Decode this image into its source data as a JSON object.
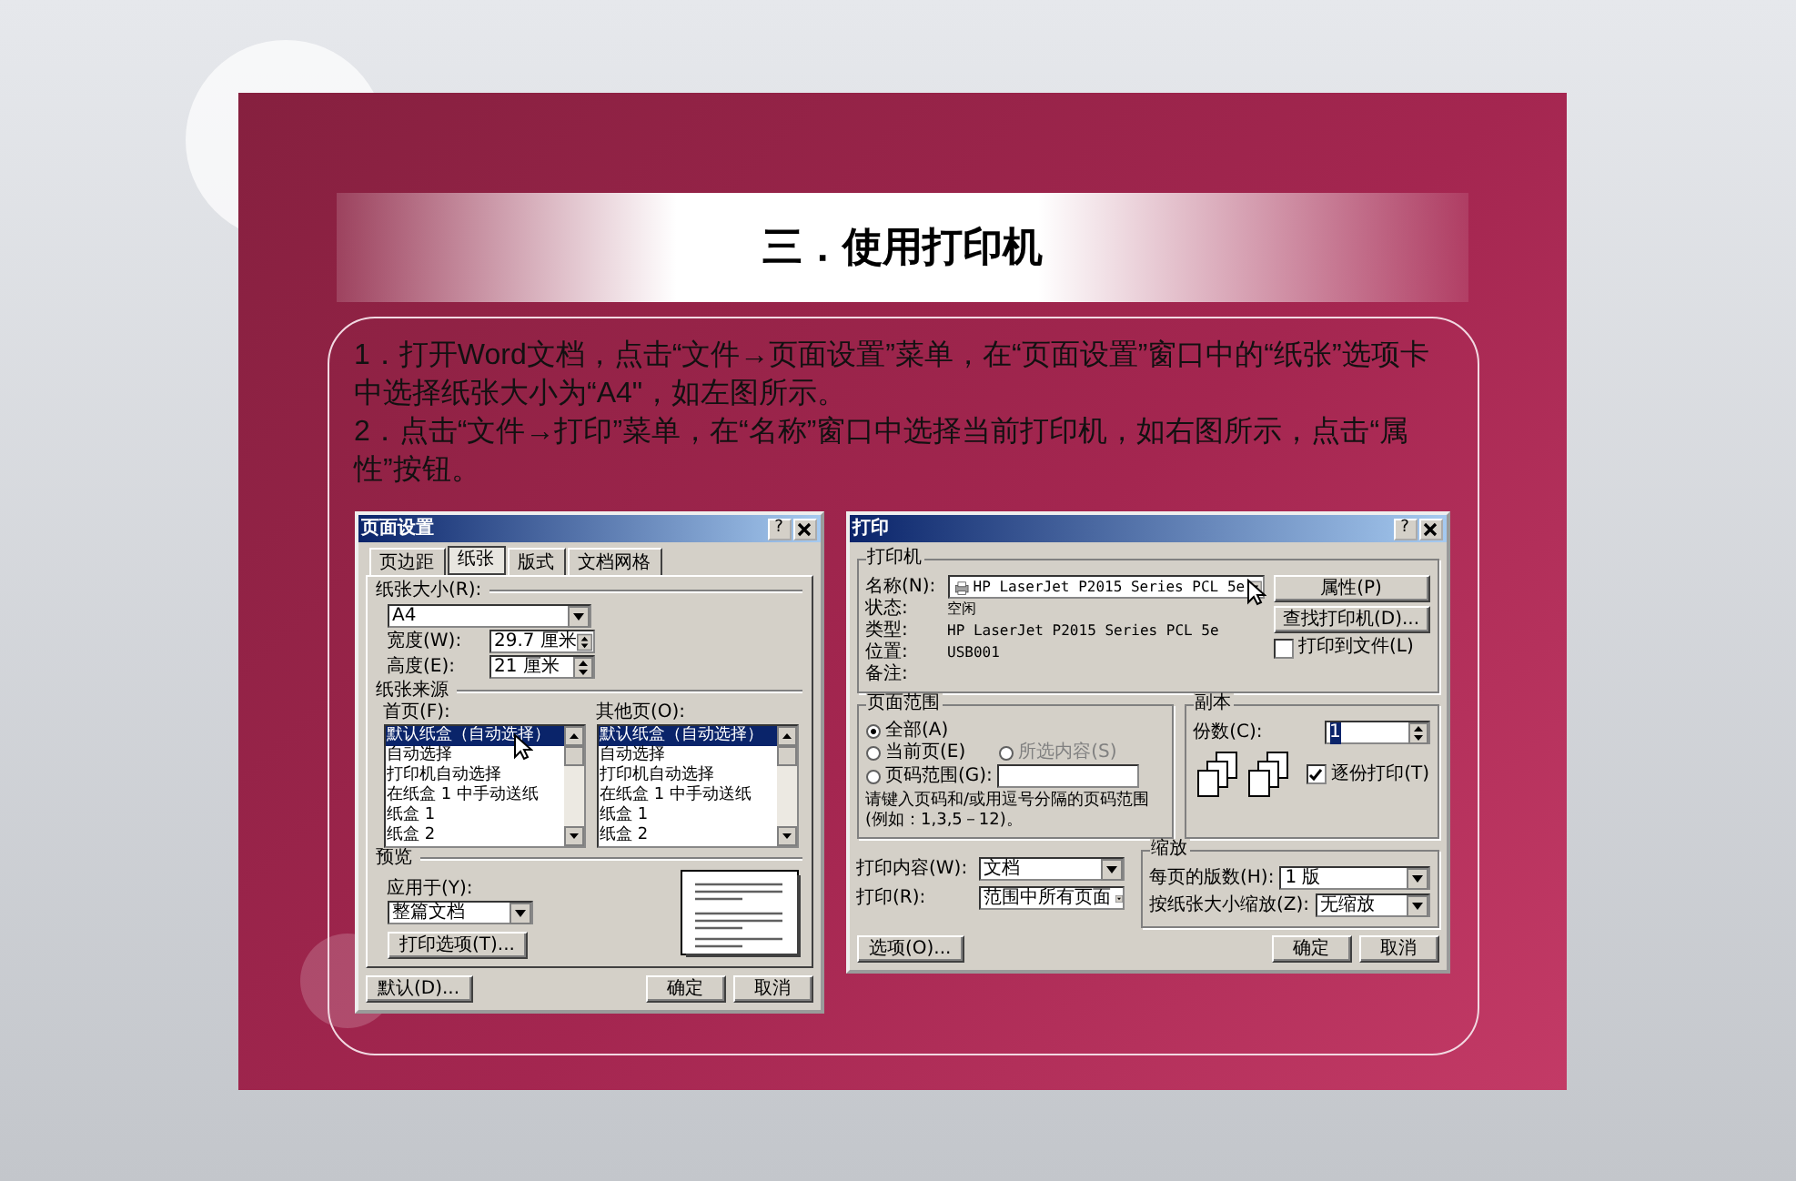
{
  "slide": {
    "title": "三．使用打印机",
    "paragraphs": [
      "1．打开Word文档，点击“文件→页面设置”菜单，在“页面设置”窗口中的“纸张”选项卡中选择纸张大小为“A4\"，如左图所示。",
      "2．点击“文件→打印”菜单，在“名称”窗口中选择当前打印机，如右图所示，点击“属性”按钮。"
    ]
  },
  "page_setup": {
    "title": "页面设置",
    "help": "?",
    "tabs": [
      {
        "label": "页边距",
        "selected": false
      },
      {
        "label": "纸张",
        "selected": true
      },
      {
        "label": "版式",
        "selected": false
      },
      {
        "label": "文档网格",
        "selected": false
      }
    ],
    "paper_size": {
      "label": "纸张大小(R):",
      "value": "A4"
    },
    "width": {
      "label": "宽度(W):",
      "value": "29.7 厘米"
    },
    "height": {
      "label": "高度(E):",
      "value": "21 厘米"
    },
    "paper_source": {
      "label": "纸张来源",
      "lists": [
        {
          "label": "首页(F):",
          "items": [
            {
              "text": "默认纸盒（自动选择）",
              "selected": true
            },
            {
              "text": "自动选择",
              "selected": false
            },
            {
              "text": "打印机自动选择",
              "selected": false
            },
            {
              "text": "在纸盒 1 中手动送纸",
              "selected": false
            },
            {
              "text": "纸盒 1",
              "selected": false
            },
            {
              "text": "纸盒 2",
              "selected": false
            }
          ]
        },
        {
          "label": "其他页(O):",
          "items": [
            {
              "text": "默认纸盒（自动选择）",
              "selected": true
            },
            {
              "text": "自动选择",
              "selected": false
            },
            {
              "text": "打印机自动选择",
              "selected": false
            },
            {
              "text": "在纸盒 1 中手动送纸",
              "selected": false
            },
            {
              "text": "纸盒 1",
              "selected": false
            },
            {
              "text": "纸盒 2",
              "selected": false
            }
          ]
        }
      ]
    },
    "preview": {
      "label": "预览",
      "apply_label": "应用于(Y):",
      "apply_value": "整篇文档"
    },
    "options_button": "打印选项(T)...",
    "buttons": [
      "默认(D)...",
      "确定",
      "取消"
    ]
  },
  "print": {
    "title": "打印",
    "help": "?",
    "printer": {
      "label": "打印机",
      "name_label": "名称(N):",
      "name_value": "HP LaserJet P2015 Series PCL 5e",
      "info": [
        {
          "label": "状态:",
          "value": "空闲"
        },
        {
          "label": "类型:",
          "value": "HP LaserJet P2015 Series PCL 5e"
        },
        {
          "label": "位置:",
          "value": "USB001"
        },
        {
          "label": "备注:"
        }
      ],
      "buttons": [
        "属性(P)",
        "查找打印机(D)..."
      ],
      "print_to_file": {
        "label": "打印到文件(L)",
        "checked": false
      }
    },
    "page_range": {
      "label": "页面范围",
      "options": [
        {
          "label": "全部(A)",
          "selected": true,
          "disabled": false
        },
        {
          "label": "当前页(E)",
          "selected": false,
          "disabled": false
        },
        {
          "label": "所选内容(S)",
          "selected": false,
          "disabled": true
        },
        {
          "label": "页码范围(G):",
          "selected": false,
          "disabled": false
        }
      ],
      "hint": "请键入页码和/或用逗号分隔的页码范围(例如：1,3,5－12)。"
    },
    "copies": {
      "label": "副本",
      "count_label": "份数(C):",
      "count_value": "1",
      "collate": {
        "label": "逐份打印(T)",
        "checked": true
      }
    },
    "print_what": {
      "label": "打印内容(W):",
      "value": "文档"
    },
    "print_pages": {
      "label": "打印(R):",
      "value": "范围中所有页面"
    },
    "zoom": {
      "label": "缩放",
      "rows": [
        {
          "label": "每页的版数(H):",
          "value": "1 版"
        },
        {
          "label": "按纸张大小缩放(Z):",
          "value": "无缩放"
        }
      ]
    },
    "options_button": "选项(O)...",
    "buttons": [
      "确定",
      "取消"
    ]
  }
}
